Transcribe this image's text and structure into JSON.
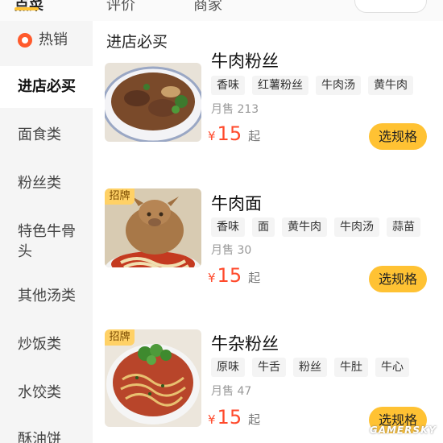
{
  "sidebar": {
    "hot_label": "热销",
    "items": [
      "进店必买",
      "面食类",
      "粉丝类",
      "特色牛骨头",
      "其他汤类",
      "炒饭类",
      "水饺类",
      "酥油饼"
    ]
  },
  "section_title": "进店必买",
  "dishes": [
    {
      "name": "牛肉粉丝",
      "badge": "",
      "tags": [
        "香味",
        "红薯粉丝",
        "牛肉汤",
        "黄牛肉"
      ],
      "sold": "月售 213",
      "currency": "¥",
      "price": "15",
      "price_suffix": "起",
      "button": "选规格"
    },
    {
      "name": "牛肉面",
      "badge": "招牌",
      "tags": [
        "香味",
        "面",
        "黄牛肉",
        "牛肉汤",
        "蒜苗"
      ],
      "sold": "月售 30",
      "currency": "¥",
      "price": "15",
      "price_suffix": "起",
      "button": "选规格"
    },
    {
      "name": "牛杂粉丝",
      "badge": "招牌",
      "tags": [
        "原味",
        "牛舌",
        "粉丝",
        "牛肚",
        "牛心"
      ],
      "sold": "月售 47",
      "currency": "¥",
      "price": "15",
      "price_suffix": "起",
      "button": "选规格"
    }
  ],
  "watermark": "GAMERSKY",
  "colors": {
    "accent": "#ffc233",
    "price": "#ff4a2c",
    "sidebar_bg": "#f5f5f5",
    "hot_icon": "#ff5a2c"
  }
}
